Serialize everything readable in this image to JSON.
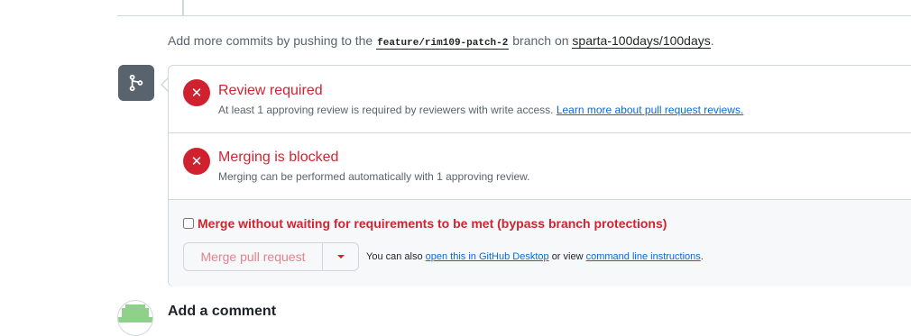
{
  "push_hint": {
    "prefix": "Add more commits by pushing to the",
    "branch": "feature/rim109-patch-2",
    "middle": "branch on",
    "repo": "sparta-100days/100days",
    "suffix": "."
  },
  "checks": [
    {
      "title": "Review required",
      "description": "At least 1 approving review is required by reviewers with write access.",
      "link": "Learn more about pull request reviews."
    },
    {
      "title": "Merging is blocked",
      "description": "Merging can be performed automatically with 1 approving review."
    }
  ],
  "bypass": {
    "label": "Merge without waiting for requirements to be met (bypass branch protections)"
  },
  "merge": {
    "button_label": "Merge pull request",
    "also_prefix": "You can also",
    "desktop_link": "open this in GitHub Desktop",
    "or_view": "or view",
    "cli_link": "command line instructions",
    "suffix": "."
  },
  "comment": {
    "heading": "Add a comment"
  },
  "colors": {
    "danger": "#cf222e",
    "link": "#0969da",
    "muted": "#59636e",
    "border": "#d0d7de"
  },
  "icons": {
    "merge_badge": "git-branch-icon",
    "check_status": "x-icon",
    "dropdown": "triangle-down-icon"
  }
}
